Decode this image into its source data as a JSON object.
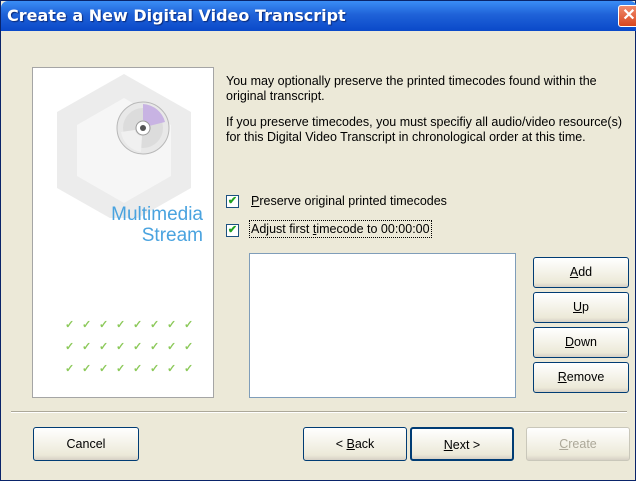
{
  "window": {
    "title": "Create a New Digital Video Transcript",
    "close_glyph": "✕"
  },
  "side_panel": {
    "label_line1": "Multimedia",
    "label_line2": "Stream",
    "icon": "cd-disc-icon",
    "check_glyph": "✓"
  },
  "content": {
    "paragraph1": "You may optionally preserve the printed timecodes found within the original transcript.",
    "paragraph2": "If you preserve timecodes, you must specifiy all audio/video resource(s) for this Digital Video Transcript in chronological order at this time.",
    "checkbox1": {
      "label": "Preserve original printed timecodes",
      "checked": true
    },
    "checkbox2": {
      "label": "Adjust first timecode to 00:00:00",
      "checked": true
    },
    "check_mark": "✔"
  },
  "list_buttons": {
    "add": "Add",
    "up": "Up",
    "down": "Down",
    "remove": "Remove"
  },
  "footer": {
    "cancel": "Cancel",
    "back": "< Back",
    "next": "Next >",
    "create": "Create"
  }
}
